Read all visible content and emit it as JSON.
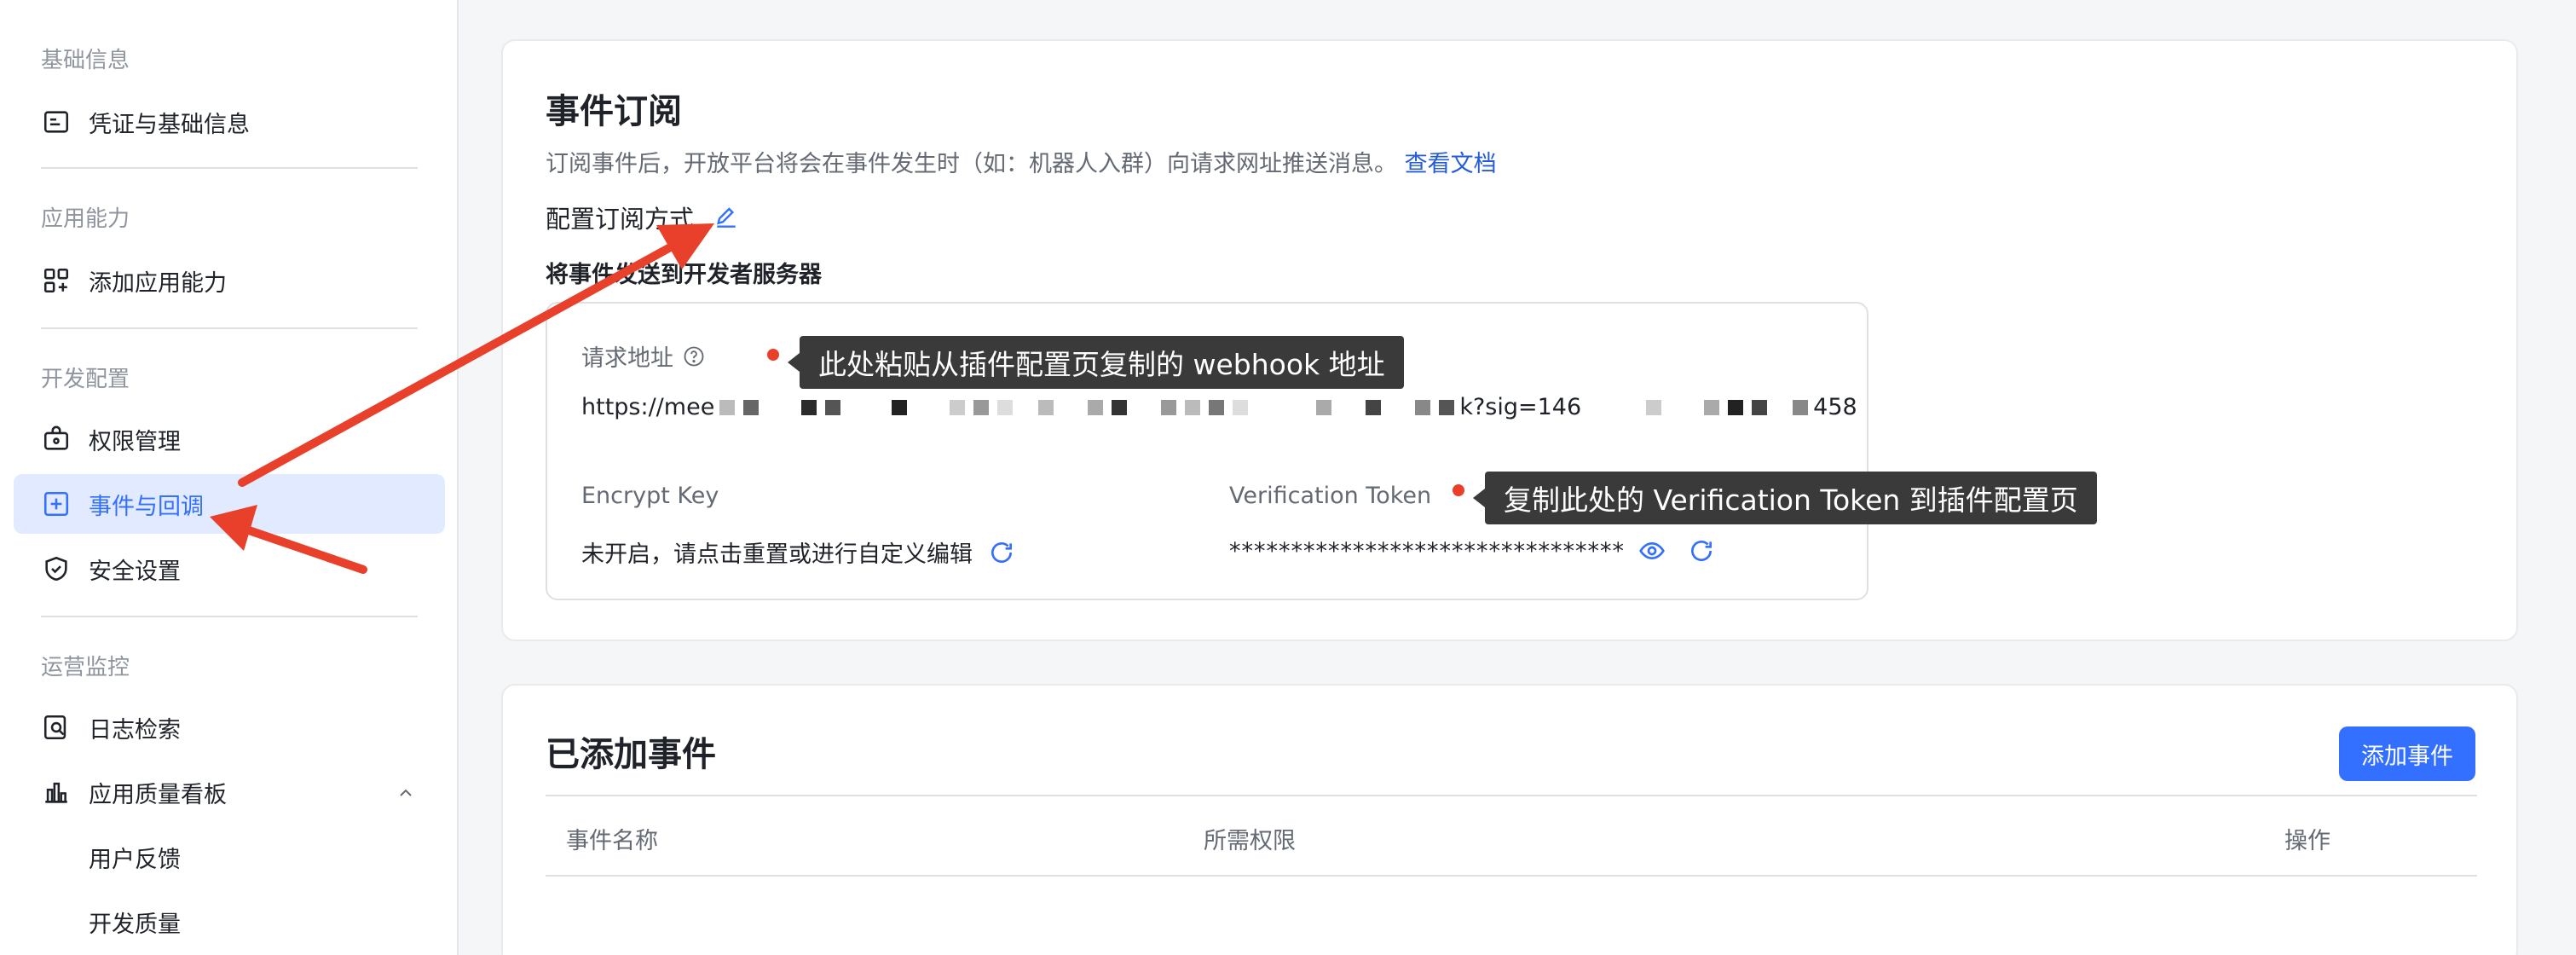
{
  "sidebar": {
    "groups": [
      {
        "title": "基础信息",
        "items": [
          {
            "label": "凭证与基础信息",
            "icon": "credential-icon"
          }
        ]
      },
      {
        "title": "应用能力",
        "items": [
          {
            "label": "添加应用能力",
            "icon": "apps-add-icon"
          }
        ]
      },
      {
        "title": "开发配置",
        "items": [
          {
            "label": "权限管理",
            "icon": "permission-icon"
          },
          {
            "label": "事件与回调",
            "icon": "event-icon",
            "active": true
          },
          {
            "label": "安全设置",
            "icon": "shield-icon"
          }
        ]
      },
      {
        "title": "运营监控",
        "items": [
          {
            "label": "日志检索",
            "icon": "log-search-icon"
          },
          {
            "label": "应用质量看板",
            "icon": "bar-chart-icon",
            "expanded": true
          },
          {
            "label": "用户反馈"
          },
          {
            "label": "开发质量"
          }
        ]
      }
    ]
  },
  "event_sub": {
    "title": "事件订阅",
    "description": "订阅事件后，开放平台将会在事件发生时（如：机器人入群）向请求网址推送消息。",
    "doc_link": "查看文档",
    "config_label": "配置订阅方式",
    "mode_label": "将事件发送到开发者服务器",
    "request_url_label": "请求地址",
    "request_url_prefix": "https://mee",
    "request_url_mid": "k?sig=146",
    "request_url_suffix": "458",
    "encrypt_key_label": "Encrypt Key",
    "encrypt_key_value": "未开启，请点击重置或进行自定义编辑",
    "verification_token_label": "Verification Token",
    "verification_token_value": "********************************"
  },
  "annotations": {
    "tip1": "此处粘贴从插件配置页复制的 webhook 地址",
    "tip2": "复制此处的 Verification Token 到插件配置页"
  },
  "events": {
    "title": "已添加事件",
    "add_button": "添加事件",
    "columns": [
      "事件名称",
      "所需权限",
      "操作"
    ]
  },
  "colors": {
    "accent": "#3370ff",
    "active_bg": "#e1eaff",
    "annotation_red": "#e8402a",
    "tooltip_bg": "#3a3a3a"
  }
}
